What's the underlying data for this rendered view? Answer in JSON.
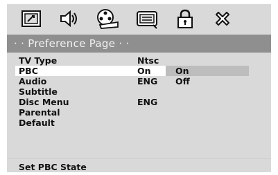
{
  "header": {
    "title": "· · Preference Page · ·"
  },
  "toolbar": {
    "icons": [
      "general-setup-icon",
      "audio-setup-icon",
      "video-setup-icon",
      "preference-icon",
      "password-lock-icon",
      "exit-icon"
    ]
  },
  "menu": {
    "items": [
      {
        "label": "TV Type",
        "value": "Ntsc"
      },
      {
        "label": "PBC",
        "value": "On"
      },
      {
        "label": "Audio",
        "value": "ENG"
      },
      {
        "label": "Subtitle",
        "value": ""
      },
      {
        "label": "Disc Menu",
        "value": "ENG"
      },
      {
        "label": "Parental",
        "value": ""
      },
      {
        "label": "Default",
        "value": ""
      }
    ],
    "options": [
      "On",
      "Off"
    ]
  },
  "status": {
    "text": "Set PBC State"
  },
  "colors": {
    "screen_bg": "#d9d9d9",
    "header_bg": "#8f8f8f",
    "selected_row": "#ffffff",
    "selected_option": "#bdbdbd"
  }
}
